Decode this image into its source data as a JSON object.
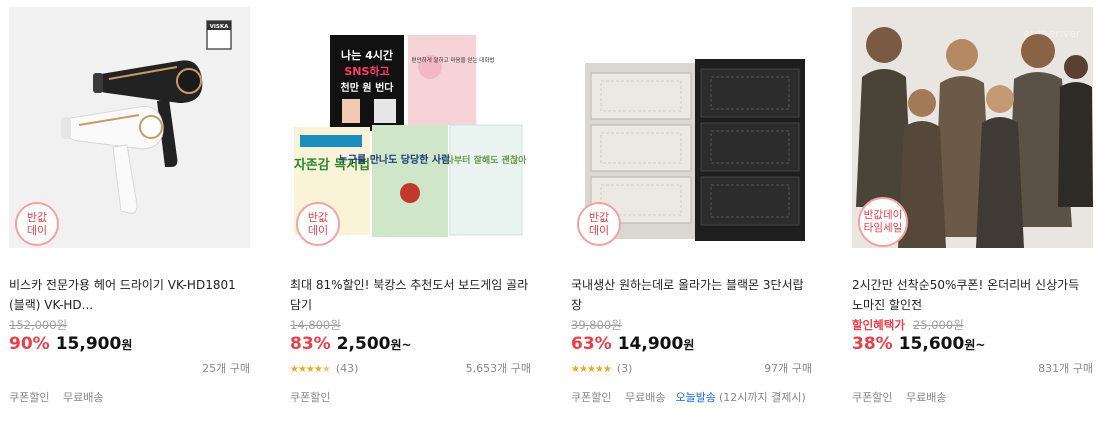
{
  "products": [
    {
      "title": "비스카 전문가용 헤어 드라이기 VK-HD1801 (블랙) VK-HD...",
      "badge": [
        "반값",
        "데이"
      ],
      "brand_mark": "VISKA",
      "original_price": "152,000원",
      "discount": "90%",
      "price": "15,900",
      "won": "원",
      "sold": "25개 구매",
      "tags": [
        "쿠폰할인",
        "무료배송"
      ]
    },
    {
      "title": "최대 81%할인! 북캉스 추천도서 보드게임 골라담기",
      "badge": [
        "반값",
        "데이"
      ],
      "book_titles": [
        "나는 4시간",
        "SNS하고",
        "천만 원 번다",
        "편안하게 말하고 마음을 얻는 대화법",
        "자존감 독서법",
        "누구를 만나도 당당한 사람의 비밀",
        "나부터 잘해도 괜찮아"
      ],
      "original_price": "14,800원",
      "discount": "83%",
      "price": "2,500",
      "won": "원~",
      "stars": "★★★★",
      "review_count": "(43)",
      "sold": "5,653개 구매",
      "tags": [
        "쿠폰할인"
      ]
    },
    {
      "title": "국내생산 원하는데로 올라가는 블랙몬 3단서랍장",
      "badge": [
        "반값",
        "데이"
      ],
      "original_price": "39,800원",
      "discount": "63%",
      "price": "14,900",
      "won": "원",
      "stars": "★★★★★",
      "review_count": "(3)",
      "sold": "97개 구매",
      "tags": [
        "쿠폰할인",
        "무료배송"
      ],
      "today_ship": "오늘발송",
      "today_note": "(12시까지 결제시)"
    },
    {
      "title": "2시간만 선착순50%쿠폰! 온더리버 신상가득 노마진 할인전",
      "badge": [
        "반값데이",
        "타임세일"
      ],
      "watermark": "ontheriver",
      "promo_label": "할인혜택가",
      "original_price": "25,000원",
      "discount": "38%",
      "price": "15,600",
      "won": "원~",
      "sold": "831개 구매",
      "tags": [
        "쿠폰할인",
        "무료배송"
      ]
    }
  ],
  "colors": {
    "accent_red": "#e8404a",
    "star": "#f5a623",
    "link_blue": "#1a6fd1",
    "thumb_bg": "#f1f1f1"
  }
}
